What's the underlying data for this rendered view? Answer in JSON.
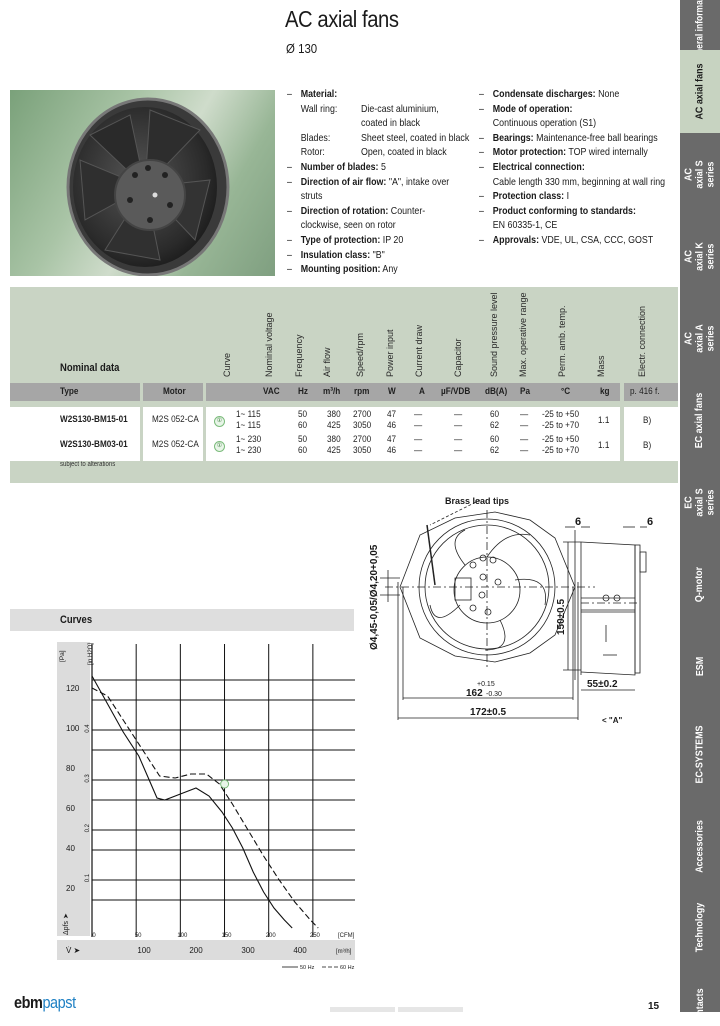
{
  "header": {
    "title": "AC axial fans",
    "subtitle": "Ø 130"
  },
  "specs_left": {
    "material_label": "Material:",
    "material_rows": [
      {
        "key": "Wall ring:",
        "value": "Die-cast aluminium,"
      },
      {
        "key": "",
        "value": "coated in black"
      },
      {
        "key": "Blades:",
        "value": "Sheet steel, coated in black"
      },
      {
        "key": "Rotor:",
        "value": "Open, coated in black"
      }
    ],
    "items": [
      {
        "label": "Number of blades:",
        "value": " 5"
      },
      {
        "label": "Direction of air flow:",
        "value": " \"A\", intake over struts"
      },
      {
        "label": "Direction of rotation:",
        "value": " Counter-clockwise, seen on rotor"
      },
      {
        "label": "Type of protection:",
        "value": " IP 20"
      },
      {
        "label": "Insulation class:",
        "value": " \"B\""
      },
      {
        "label": "Mounting position:",
        "value": " Any"
      }
    ]
  },
  "specs_right": {
    "items": [
      {
        "label": "Condensate discharges:",
        "value": " None"
      },
      {
        "label": "Mode of operation:",
        "value": "",
        "sub": "Continuous operation (S1)"
      },
      {
        "label": "Bearings:",
        "value": " Maintenance-free ball bearings"
      },
      {
        "label": "Motor protection:",
        "value": " TOP wired internally"
      },
      {
        "label": "Electrical connection:",
        "value": "",
        "sub": "Cable length 330 mm, beginning at wall ring"
      },
      {
        "label": "Protection class:",
        "value": " I"
      },
      {
        "label": "Product conforming to standards:",
        "value": "",
        "sub": "EN 60335-1, CE"
      },
      {
        "label": "Approvals:",
        "value": " VDE, UL, CSA, CCC, GOST"
      }
    ]
  },
  "sidebar": {
    "tabs": [
      {
        "label": "General information",
        "short": "Gener\nInforma",
        "active": false
      },
      {
        "label": "AC axial fans",
        "active": true
      },
      {
        "label": "AC axial S series",
        "active": false
      },
      {
        "label": "AC axial K series",
        "active": false
      },
      {
        "label": "AC axial A series",
        "active": false
      },
      {
        "label": "EC axial fans",
        "active": false
      },
      {
        "label": "EC axial S series",
        "active": false
      },
      {
        "label": "Q-motor",
        "active": false
      },
      {
        "label": "ESM",
        "active": false
      },
      {
        "label": "EC-SYSTEMS",
        "active": false
      },
      {
        "label": "Accessories",
        "active": false
      },
      {
        "label": "Technology",
        "active": false
      },
      {
        "label": "Contacts",
        "active": false
      }
    ],
    "colors": {
      "tab_bg": "#6a6a6a",
      "active_bg": "#c7d3c1"
    }
  },
  "table": {
    "title": "Nominal data",
    "vertical_headers": [
      "Curve",
      "Nominal voltage",
      "Frequency",
      "Air flow",
      "Speed/rpm",
      "Power input",
      "Current draw",
      "Capacitor",
      "Sound pressure level",
      "Max. operative range",
      "Perm. amb. temp.",
      "Mass",
      "Electr. connection"
    ],
    "units": {
      "type": "Type",
      "motor": "Motor",
      "voltage": "VAC",
      "freq": "Hz",
      "airflow": "m³/h",
      "speed": "rpm",
      "power": "W",
      "current": "A",
      "capacitor": "µF/VDB",
      "sound": "dB(A)",
      "pressure": "Pa",
      "temp": "°C",
      "mass": "kg",
      "conn": "p. 416 f."
    },
    "rows": [
      {
        "type": "W2S130-BM15-01",
        "motor": "M2S 052-CA",
        "curve": "①",
        "lines": [
          {
            "voltage": "1~ 115",
            "freq": "50",
            "airflow": "380",
            "speed": "2700",
            "power": "47",
            "current": "—",
            "capacitor": "—",
            "sound": "60",
            "pressure": "—",
            "temp": "-25 to +50"
          },
          {
            "voltage": "1~ 115",
            "freq": "60",
            "airflow": "425",
            "speed": "3050",
            "power": "46",
            "current": "—",
            "capacitor": "—",
            "sound": "62",
            "pressure": "—",
            "temp": "-25 to +70"
          }
        ],
        "mass": "1.1",
        "conn": "B)"
      },
      {
        "type": "W2S130-BM03-01",
        "motor": "M2S 052-CA",
        "curve": "①",
        "lines": [
          {
            "voltage": "1~ 230",
            "freq": "50",
            "airflow": "380",
            "speed": "2700",
            "power": "47",
            "current": "—",
            "capacitor": "—",
            "sound": "60",
            "pressure": "—",
            "temp": "-25 to +50"
          },
          {
            "voltage": "1~ 230",
            "freq": "60",
            "airflow": "425",
            "speed": "3050",
            "power": "46",
            "current": "—",
            "capacitor": "—",
            "sound": "62",
            "pressure": "—",
            "temp": "-25 to +70"
          }
        ],
        "mass": "1.1",
        "conn": "B)"
      }
    ],
    "footnote": "subject to alterations",
    "colors": {
      "band": "#c9d4c4",
      "unit_bar": "#a6a6a6"
    }
  },
  "curves": {
    "title": "Curves"
  },
  "chart_data": {
    "type": "line",
    "title": "Curves",
    "xlabel": "V̇ [m³/h]",
    "ylabel": "Δpfs [Pa]",
    "x_unit_primary": "[m³/h]",
    "x_unit_secondary": "[CFM]",
    "y_unit_primary": "[Pa]",
    "y_unit_secondary": "[in H2O]",
    "xlim": [
      0,
      450
    ],
    "ylim": [
      0,
      130
    ],
    "x_ticks": [
      "100",
      "200",
      "300",
      "400"
    ],
    "x_ticks_secondary": [
      "0",
      "50",
      "100",
      "150",
      "200",
      "250"
    ],
    "y_ticks": [
      "20",
      "40",
      "60",
      "80",
      "100",
      "120"
    ],
    "y_ticks_secondary": [
      "0.1",
      "0.2",
      "0.3",
      "0.4"
    ],
    "grid": true,
    "legend": "bottom-right",
    "series": [
      {
        "name": "50 Hz",
        "style": "solid",
        "x": [
          0,
          30,
          60,
          90,
          110,
          125,
          140,
          170,
          200,
          225,
          250,
          270,
          290,
          310,
          330,
          350,
          370,
          385
        ],
        "y": [
          126,
          112,
          98,
          86,
          74,
          65,
          64,
          67,
          70,
          66,
          58,
          50,
          40,
          28,
          18,
          10,
          4,
          0
        ]
      },
      {
        "name": "60 Hz",
        "style": "dashed",
        "x": [
          0,
          30,
          60,
          100,
          130,
          160,
          190,
          220,
          245,
          270,
          300,
          330,
          360,
          390,
          420,
          435
        ],
        "y": [
          120,
          116,
          104,
          88,
          76,
          75,
          77,
          77,
          72,
          62,
          49,
          36,
          24,
          13,
          4,
          0
        ]
      }
    ],
    "annotations": [
      "①"
    ]
  },
  "drawing": {
    "label_leads": "Brass lead tips",
    "dim_hole": "Ø4,45-0,05/Ø4,20+0,05",
    "dim_162": "162",
    "dim_162_tol_up": "+0.15",
    "dim_162_tol_down": "-0.30",
    "dim_172": "172±0.5",
    "dim_150": "150±0.5",
    "dim_55": "55±0.2",
    "dim_6_left": "6",
    "dim_6_right": "6",
    "view_label": "< \"A\""
  },
  "footer": {
    "logo_a": "ebm",
    "logo_b": "papst",
    "page_number": "15"
  }
}
